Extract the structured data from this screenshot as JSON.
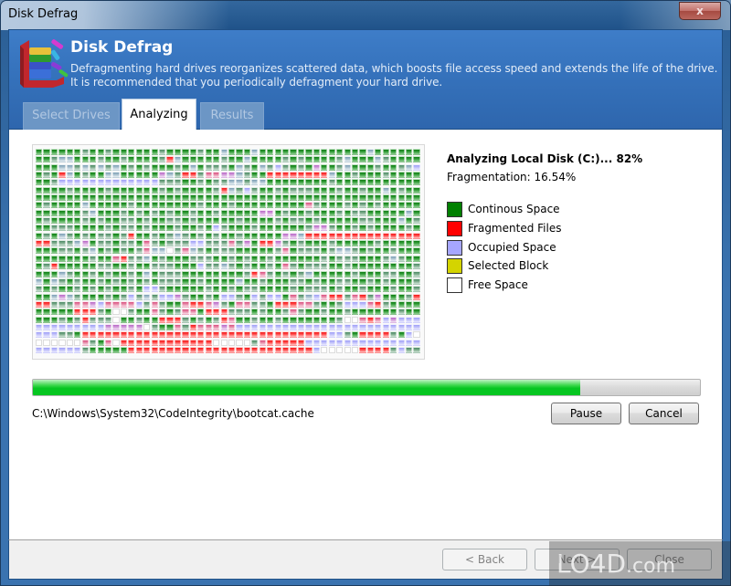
{
  "window": {
    "title": "Disk Defrag",
    "close_glyph": "x"
  },
  "header": {
    "title": "Disk Defrag",
    "description_line1": "Defragmenting hard drives reorganizes scattered data, which boosts file access speed and extends the life of the drive.",
    "description_line2": "It is recommended that you periodically defragment your hard drive.",
    "icon": "disk-defrag-blocks-icon"
  },
  "tabs": [
    {
      "label": "Select Drives",
      "state": "inactive"
    },
    {
      "label": "Analyzing",
      "state": "active"
    },
    {
      "label": "Results",
      "state": "inactive"
    }
  ],
  "status": {
    "title": "Analyzing Local Disk (C:)... 82%",
    "fragmentation": "Fragmentation: 16.54%"
  },
  "legend": [
    {
      "label": "Continous Space",
      "color": "#008000"
    },
    {
      "label": "Fragmented Files",
      "color": "#ff0000"
    },
    {
      "label": "Occupied Space",
      "color": "#a6a6ff"
    },
    {
      "label": "Selected Block",
      "color": "#d4d400"
    },
    {
      "label": "Free Space",
      "color": "#ffffff"
    }
  ],
  "cluster_map": {
    "columns": 50,
    "legend_codes": {
      "G": "continuous (dark green)",
      "g": "continuous (faded green)",
      "b": "continuous (grey-blue)",
      "R": "fragmented (red)",
      "r": "fragmented (pink)",
      "B": "occupied (blue)",
      "P": "occupied/fragmented mix (purple)",
      "W": "free space (white)"
    },
    "rows": [
      "GGGGGGgGGgGGGGGGgGGGGgGGbGGGbGGGGGGGGGGGGGGbGGGGGG",
      "GGgbbGGGgGGgGGGGgRbGGGGGgGGbGGGGgGgGGGGgbGGGbgGGGG",
      "GGGbbgbgbgbGgGgGGGgGbGgggGbgGbgBgGgGPGGgbGGGgGGgbB",
      "GgGRbGgGGbbGGGGGPbgRRgrrPPbgGGRRRRRRRRbGGgGGGgGGGG",
      "GGgBBBBBBBBBBBBBgggGGgGggbbgbbGGGGGGGGgGGGGGGGGGGG",
      "GGGGgGGGGgGGGGGGgGgGGGGgRbgBgGGgGgggGGGgGGgGGbGgGG",
      "GGGGGGGGGGGGGGGGGGGGGGGGGGGGGGGGGGGGGGGGGGGGGGGGGG",
      "GgGGGGbGGGGGgGGGGGGGGgGGGgGGGGGGGGGrgGGGgGgGgGGGGG",
      "GGGGGGgbGGGgGgGgGgGGgGGgGGGGGPPGgGGgGGGgGggGGGGGbG",
      "GgGGGGgGgGGggGgGGggGgGGGGGgGGGGgGggGgGGGGGggGGGbGg",
      "GGgggGGGGgGggGgGGGgGGgGBgGGGgGGGGGGgPPgGGgGgGGGGgG",
      "GgGbgGgGggGgRGGgGgbgGgGgGGgGGGGGPPbRRRRRRRRRRRRRRR",
      "RRgggbPGggGggGrgGgggBBgggrgPGRRPgGgGGGgGGGGGgGGGGG",
      "GGGggGgbGgGgGgrbbWgrbgGgggGGGGGgrGgggGgbbgGgGGgGGG",
      "GGGGGGGgGGrRggbGgGGGgggGGgGgGGgGGGGGGgGgggGGGgbgGG",
      "GgRGGGGGggGGgGGgggGGGBggbgGgGGgGrgGgggGGgGGGGGGGGg",
      "GGGbgGGgGgGGgGbGgggGGGGGGGGgRrgGgGgbGGGGGgGGGggGGg",
      "bGbgGgGGgGgGgGgGgggGGgGGGGbGGgGGGggGgGGggGGgGgGGGg",
      "gGgGGgGgGgGGgGBBgGGGGGgGGgGggGGGGgGgggGgGGgGGGgGGg",
      "GGbPbgGGGgGgBgbgBBPgGGgGBBgGBgBBGrgbBrRRgrRgPGGGgR",
      "RRgggrrPBrrrrBgrgGGrRRrPgGrrggGRRRrrgGGgBBBrRgGGGG",
      "GGGGGRRRgGWWgGGrgGgrrGRRRgggGgGGgrgGGgGGgGGGGGGgGG",
      "GGGgGgRgggWGGgGGRRRgGgGgRrGGgGGgGGGGGGGgWWrRrBPBBB",
      "BBBBBBBBBPPPPPWgGGrgRrrrPrBBBBBBBBBBBBBBBBBBBBBBBB",
      "BBBggGRRRRRRRRRRRRRRRRRRRRRRRRRRRRRRRRBBgGRRRRgGBW",
      "WWWWWWrgGrWRRRRRRRRRRRRWWWWWgrRRRRRBBBBBBBBBBBBBBB",
      "BBBBBBgGGGGGRRRRRRRRRRRRRRRRRRRRRRRRBWWWWWRRRRgBgg"
    ]
  },
  "progress": {
    "percent": 82
  },
  "current_file": "C:\\Windows\\System32\\CodeIntegrity\\bootcat.cache",
  "buttons": {
    "pause": "Pause",
    "cancel": "Cancel",
    "back": "< Back",
    "next": "Next >",
    "close": "Close"
  },
  "watermark": {
    "text": "LO4D",
    "suffix": ".com"
  }
}
